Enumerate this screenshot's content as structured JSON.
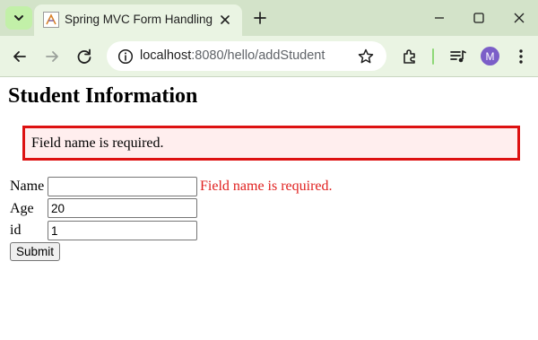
{
  "browser": {
    "tab_title": "Spring MVC Form Handling",
    "url_host": "localhost",
    "url_rest": ":8080/hello/addStudent",
    "profile_initial": "M",
    "profile_color": "#7b5ec8",
    "tabstrip_color": "#d3e3c9",
    "toolbar_color": "#eaf4e3",
    "icons": [
      "chevron-down-icon",
      "favicon-icon",
      "close-icon",
      "plus-icon",
      "minimize-icon",
      "maximize-icon",
      "window-close-icon",
      "back-arrow-icon",
      "forward-arrow-icon",
      "reload-icon",
      "info-icon",
      "star-icon",
      "extensions-icon",
      "media-queue-icon",
      "kebab-menu-icon"
    ]
  },
  "page": {
    "title": "Student Information",
    "error_summary": "Field name is required.",
    "error_color": "#e0201f",
    "error_bg": "#ffeeee",
    "form": {
      "name_label": "Name",
      "name_value": "",
      "name_error": "Field name is required.",
      "age_label": "Age",
      "age_value": "20",
      "id_label": "id",
      "id_value": "1",
      "submit_label": "Submit"
    }
  }
}
